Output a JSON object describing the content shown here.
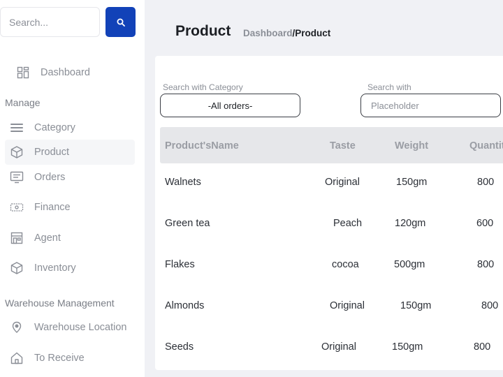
{
  "sidebar": {
    "search_placeholder": "Search...",
    "dashboard_label": "Dashboard",
    "sections": {
      "manage": "Manage",
      "warehouse": "Warehouse Management"
    },
    "manage_items": [
      {
        "label": "Category",
        "icon": "list-icon"
      },
      {
        "label": "Product",
        "icon": "box-icon"
      },
      {
        "label": "Orders",
        "icon": "receipt-icon"
      },
      {
        "label": "Finance",
        "icon": "cash-icon"
      },
      {
        "label": "Agent",
        "icon": "store-icon"
      },
      {
        "label": "Inventory",
        "icon": "box-icon"
      }
    ],
    "warehouse_items": [
      {
        "label": "Warehouse Location",
        "icon": "location-pin-icon"
      },
      {
        "label": "To Receive",
        "icon": "home-icon"
      }
    ]
  },
  "header": {
    "title": "Product",
    "breadcrumb": {
      "link": "Dashboard",
      "separator": "/",
      "current": "Product"
    }
  },
  "filters": {
    "category_label": "Search with Category",
    "category_value": "-All orders-",
    "search_label": "Search with",
    "search_placeholder": "Placeholder"
  },
  "table": {
    "columns": [
      "Product'sName",
      "Taste",
      "Weight",
      "Quantit"
    ],
    "rows": [
      {
        "name": "Walnets",
        "taste": "Original",
        "weight": "150gm",
        "quantity": "800"
      },
      {
        "name": "Green tea",
        "taste": "Peach",
        "weight": "120gm",
        "quantity": "600"
      },
      {
        "name": "Flakes",
        "taste": "cocoa",
        "weight": "500gm",
        "quantity": "800"
      },
      {
        "name": "Almonds",
        "taste": "Original",
        "weight": "150gm",
        "quantity": "800"
      },
      {
        "name": "Seeds",
        "taste": "Original",
        "weight": "150gm",
        "quantity": "800"
      }
    ]
  },
  "colors": {
    "accent": "#1242b8",
    "background": "#f0f1f5",
    "table_header": "#e6e7ea"
  }
}
